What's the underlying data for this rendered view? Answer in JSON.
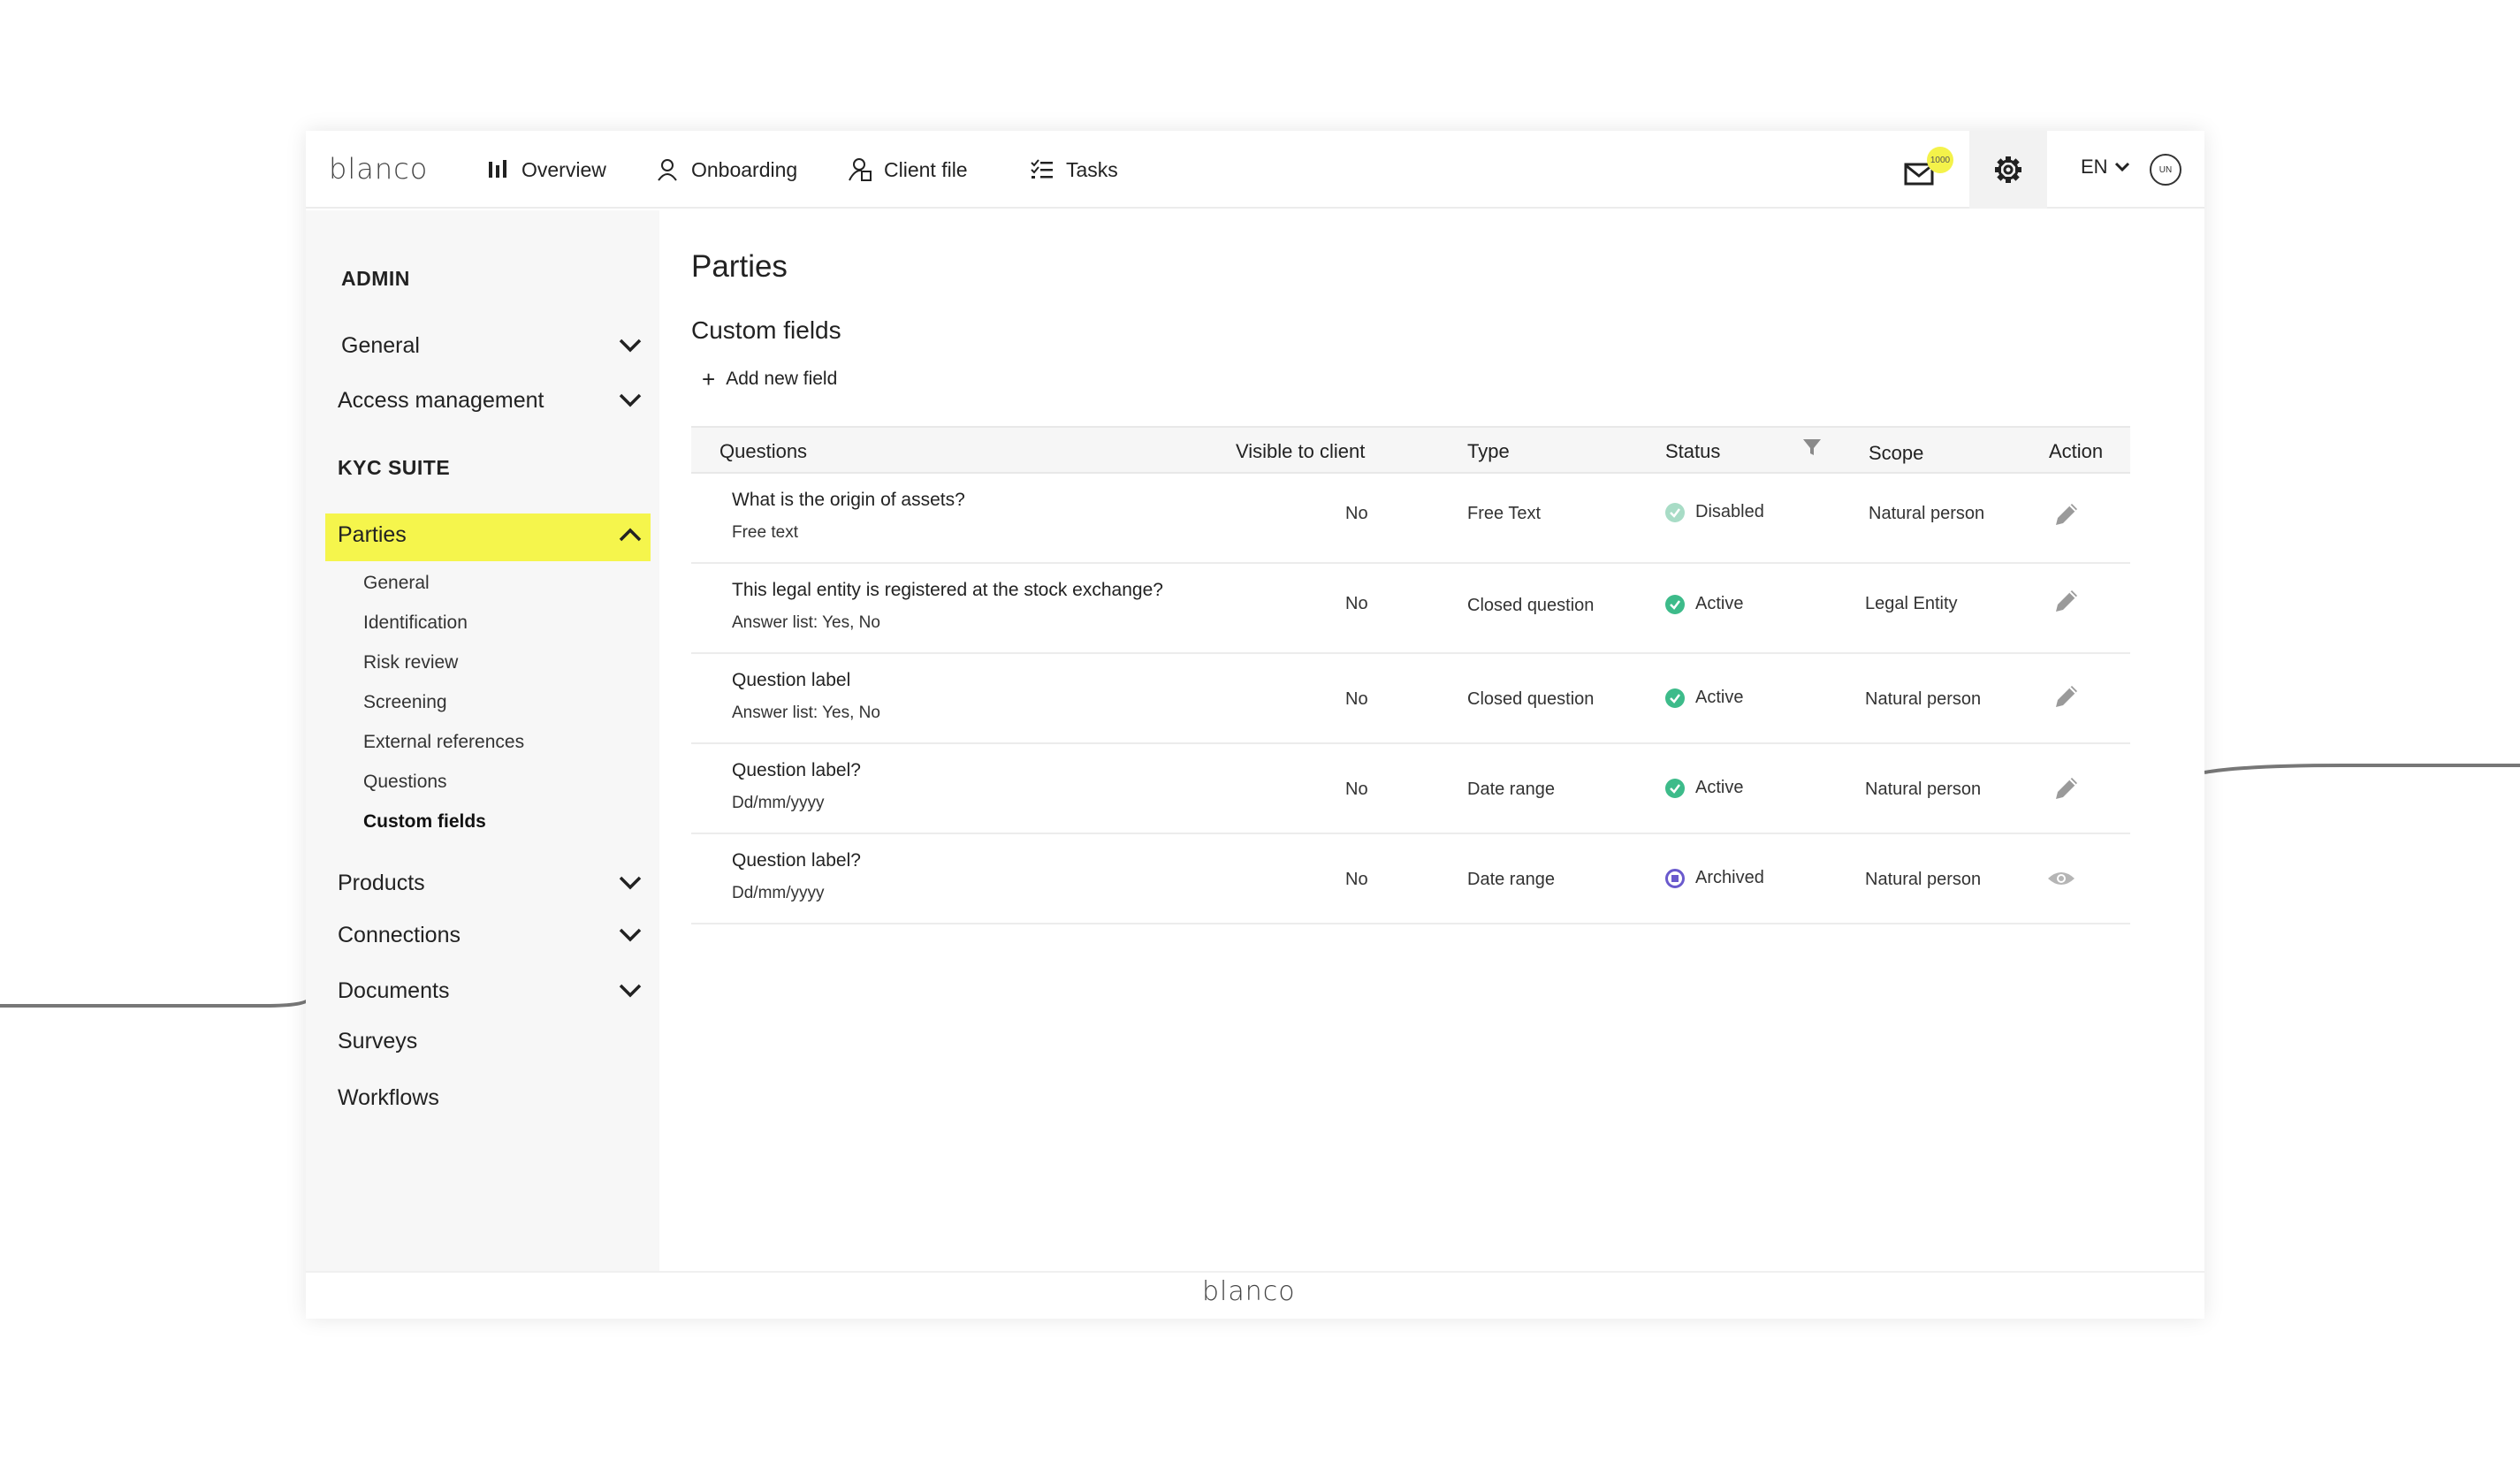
{
  "brand": {
    "logo": "blanco",
    "footer_logo": "blanco"
  },
  "nav": {
    "items": [
      {
        "label": "Overview",
        "icon": "bar-chart-icon"
      },
      {
        "label": "Onboarding",
        "icon": "user-icon"
      },
      {
        "label": "Client file",
        "icon": "client-file-icon"
      },
      {
        "label": "Tasks",
        "icon": "tasks-icon"
      }
    ],
    "mail_badge": "1000",
    "language": "EN",
    "avatar_initials": "UN"
  },
  "sidebar": {
    "admin_heading": "ADMIN",
    "admin_items": [
      {
        "label": "General"
      },
      {
        "label": "Access management"
      }
    ],
    "kyc_heading": "KYC SUITE",
    "active_item": "Parties",
    "sub_items": [
      "General",
      "Identification",
      "Risk review",
      "Screening",
      "External references",
      "Questions",
      "Custom fields"
    ],
    "current_sub": "Custom fields",
    "more_items": [
      "Products",
      "Connections",
      "Documents",
      "Surveys",
      "Workflows"
    ]
  },
  "main": {
    "page_title": "Parties",
    "section_title": "Custom fields",
    "add_label": "Add new field"
  },
  "table": {
    "columns": [
      "Questions",
      "Visible to client",
      "Type",
      "Status",
      "Scope",
      "Action"
    ],
    "rows": [
      {
        "question": "What is the origin of assets?",
        "sub": "Free text",
        "visible": "No",
        "type": "Free Text",
        "status": "Disabled",
        "scope": "Natural person",
        "action": "edit"
      },
      {
        "question": "This legal entity is registered at the stock exchange?",
        "sub": "Answer list:  Yes, No",
        "visible": "No",
        "type": "Closed question",
        "status": "Active",
        "scope": "Legal Entity",
        "action": "edit"
      },
      {
        "question": "Question label",
        "sub": "Answer list:  Yes, No",
        "visible": "No",
        "type": "Closed question",
        "status": "Active",
        "scope": "Natural person",
        "action": "edit"
      },
      {
        "question": "Question label?",
        "sub": "Dd/mm/yyyy",
        "visible": "No",
        "type": "Date range",
        "status": "Active",
        "scope": "Natural person",
        "action": "edit"
      },
      {
        "question": "Question label?",
        "sub": "Dd/mm/yyyy",
        "visible": "No",
        "type": "Date range",
        "status": "Archived",
        "scope": "Natural person",
        "action": "view"
      }
    ]
  },
  "colors": {
    "highlight": "#f5f54c",
    "active_status": "#3dbb8a",
    "disabled_status": "#a8dcc6",
    "archived_status": "#6a5acd"
  }
}
